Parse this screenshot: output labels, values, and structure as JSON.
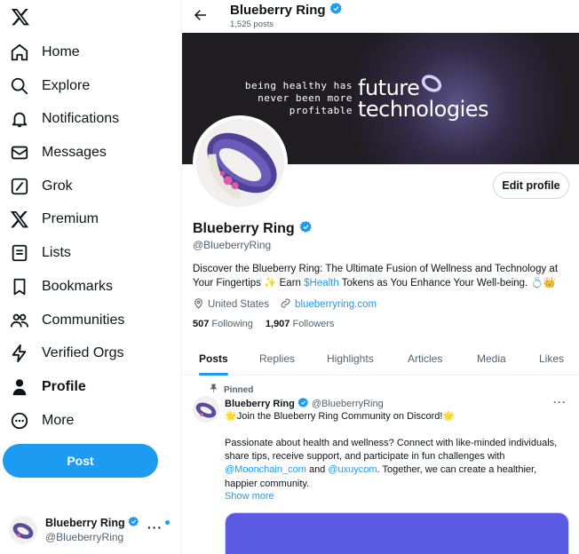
{
  "colors": {
    "accent": "#1d9bf0",
    "text": "#0f1419",
    "muted": "#536471"
  },
  "sidebar": {
    "logo_icon": "x-logo-icon",
    "items": [
      {
        "label": "Home",
        "icon": "home-icon"
      },
      {
        "label": "Explore",
        "icon": "search-icon"
      },
      {
        "label": "Notifications",
        "icon": "bell-icon"
      },
      {
        "label": "Messages",
        "icon": "envelope-icon"
      },
      {
        "label": "Grok",
        "icon": "grok-icon"
      },
      {
        "label": "Premium",
        "icon": "x-logo-icon"
      },
      {
        "label": "Lists",
        "icon": "list-icon"
      },
      {
        "label": "Bookmarks",
        "icon": "bookmark-icon"
      },
      {
        "label": "Communities",
        "icon": "people-icon"
      },
      {
        "label": "Verified Orgs",
        "icon": "lightning-icon"
      },
      {
        "label": "Profile",
        "icon": "person-icon"
      },
      {
        "label": "More",
        "icon": "more-circle-icon"
      }
    ],
    "post_button": "Post",
    "account": {
      "name": "Blueberry Ring",
      "handle": "@BlueberryRing",
      "more": "···"
    }
  },
  "header": {
    "name": "Blueberry Ring",
    "post_count": "1,525 posts"
  },
  "banner": {
    "tagline": "being healthy has never been more profitable",
    "line1": "future",
    "line2": "technologies"
  },
  "profile": {
    "edit_button": "Edit profile",
    "name": "Blueberry Ring",
    "handle": "@BlueberryRing",
    "bio_before": "Discover the Blueberry Ring: The Ultimate Fusion of Wellness and Technology at Your Fingertips ✨ Earn ",
    "bio_link": "$Health",
    "bio_after": " Tokens as You Enhance Your Well-being. 💍👑",
    "location": "United States",
    "website": "blueberryring.com",
    "following_count": "507",
    "following_label": "Following",
    "followers_count": "1,907",
    "followers_label": "Followers"
  },
  "tabs": [
    {
      "label": "Posts",
      "active": true
    },
    {
      "label": "Replies",
      "active": false
    },
    {
      "label": "Highlights",
      "active": false
    },
    {
      "label": "Articles",
      "active": false
    },
    {
      "label": "Media",
      "active": false
    },
    {
      "label": "Likes",
      "active": false
    }
  ],
  "post": {
    "pinned_label": "Pinned",
    "author_name": "Blueberry Ring",
    "author_handle": "@BlueberryRing",
    "more": "···",
    "headline": "🌟Join the Blueberry Ring Community on Discord!🌟",
    "body_1": "Passionate about health and wellness? Connect with like-minded individuals, share tips, receive support, and participate in fun challenges with ",
    "mention_1": "@Moonchain_com",
    "body_2": " and ",
    "mention_2": "@uxuycom",
    "body_3": ". Together, we can create a healthier, happier community.",
    "show_more": "Show more"
  }
}
